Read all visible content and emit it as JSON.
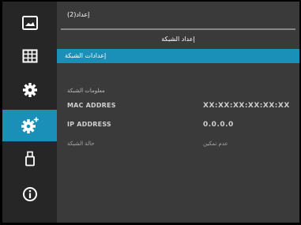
{
  "sidebar": {
    "items": [
      {
        "icon": "picture-icon",
        "active": false
      },
      {
        "icon": "grid-display-icon",
        "active": false
      },
      {
        "icon": "gear-icon",
        "active": false
      },
      {
        "icon": "gear-plus-icon",
        "active": true
      },
      {
        "icon": "usb-icon",
        "active": false
      },
      {
        "icon": "info-icon",
        "active": false
      }
    ]
  },
  "header": {
    "breadcrumb": "إعداد(2)"
  },
  "section": {
    "title": "إعداد الشبكة",
    "selected_item": "إعدادات الشبكة"
  },
  "info": {
    "header": "معلومات الشبكة",
    "rows": [
      {
        "label": "MAC ADDRES",
        "value": "XX:XX:XX:XX:XX:XX"
      },
      {
        "label": "IP ADDRESS",
        "value": "0.0.0.0"
      },
      {
        "label": "حالة الشبكة",
        "value": "عدم تمكين"
      }
    ]
  },
  "colors": {
    "accent": "#1a8fb8",
    "panel": "#3a3a3a",
    "sidebar": "#262626"
  }
}
